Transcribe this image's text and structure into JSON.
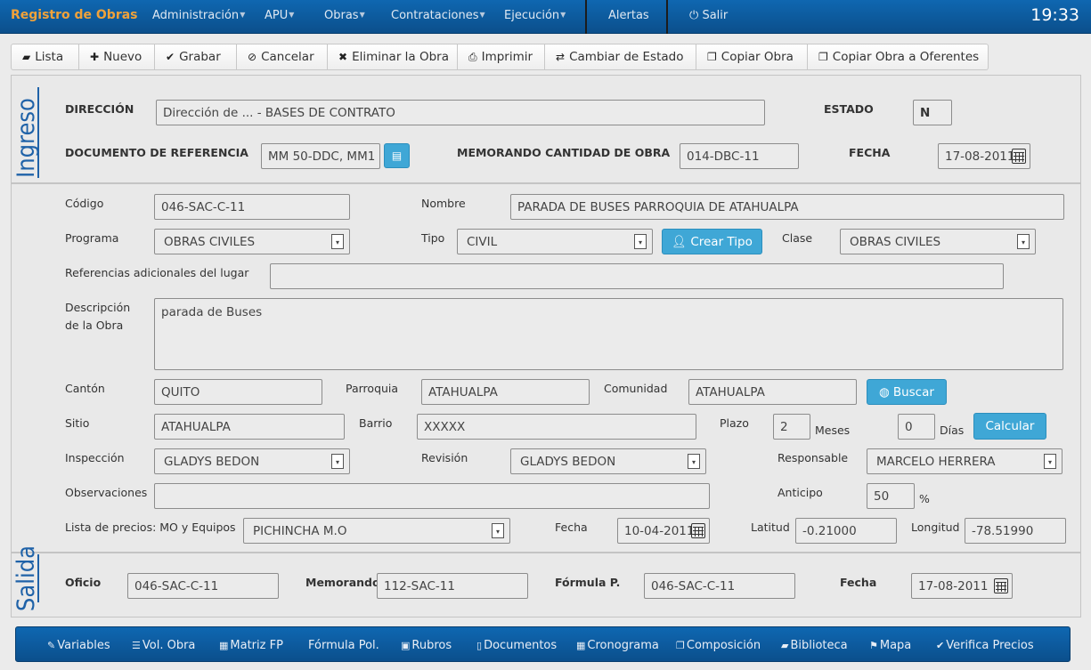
{
  "topbar": {
    "brand": "Registro de Obras",
    "menus": [
      "Administración",
      "APU",
      "Obras",
      "Contrataciones",
      "Ejecución"
    ],
    "alerts": "Alertas",
    "logout": "Salir",
    "clock": "19:33"
  },
  "toolbar": {
    "lista": "Lista",
    "nuevo": "Nuevo",
    "grabar": "Grabar",
    "cancelar": "Cancelar",
    "eliminar": "Eliminar la Obra",
    "imprimir": "Imprimir",
    "cambiar_estado": "Cambiar de Estado",
    "copiar": "Copiar Obra",
    "copiar_oferentes": "Copiar Obra a Oferentes"
  },
  "ingreso": {
    "side_label": "Ingreso",
    "direccion_label": "DIRECCIÓN",
    "direccion": "Dirección de ... - BASES DE CONTRATO",
    "estado_label": "ESTADO",
    "estado": "N",
    "doc_ref_label": "DOCUMENTO DE REFERENCIA",
    "doc_ref": "MM 50-DDC, MM1",
    "memo_label": "MEMORANDO CANTIDAD DE OBRA",
    "memo": "014-DBC-11",
    "fecha_label": "FECHA",
    "fecha": "17-08-2011"
  },
  "obra": {
    "codigo_label": "Código",
    "codigo": "046-SAC-C-11",
    "nombre_label": "Nombre",
    "nombre": "PARADA DE BUSES PARROQUIA DE ATAHUALPA",
    "programa_label": "Programa",
    "programa": "OBRAS CIVILES",
    "tipo_label": "Tipo",
    "tipo": "CIVIL",
    "crear_tipo": "Crear Tipo",
    "clase_label": "Clase",
    "clase": "OBRAS CIVILES",
    "referencias_label": "Referencias adicionales del lugar",
    "referencias": "",
    "descripcion_label_1": "Descripción",
    "descripcion_label_2": "de la Obra",
    "descripcion": "parada de Buses",
    "canton_label": "Cantón",
    "canton": "QUITO",
    "parroquia_label": "Parroquia",
    "parroquia": "ATAHUALPA",
    "comunidad_label": "Comunidad",
    "comunidad": "ATAHUALPA",
    "buscar": "Buscar",
    "sitio_label": "Sitio",
    "sitio": "ATAHUALPA",
    "barrio_label": "Barrio",
    "barrio": "XXXXX",
    "plazo_label": "Plazo",
    "plazo_meses": "2",
    "meses_label": "Meses",
    "plazo_dias": "0",
    "dias_label": "Días",
    "calcular": "Calcular",
    "inspeccion_label": "Inspección",
    "inspeccion": "GLADYS BEDON",
    "revision_label": "Revisión",
    "revision": "GLADYS BEDON",
    "responsable_label": "Responsable",
    "responsable": "MARCELO HERRERA",
    "observaciones_label": "Observaciones",
    "observaciones": "",
    "anticipo_label": "Anticipo",
    "anticipo": "50",
    "pct": "%",
    "lista_precios_label": "Lista de precios: MO y Equipos",
    "lista_precios": "PICHINCHA M.O",
    "fecha_label": "Fecha",
    "fecha": "10-04-2011",
    "latitud_label": "Latitud",
    "latitud": "-0.21000",
    "longitud_label": "Longitud",
    "longitud": "-78.51990"
  },
  "salida": {
    "side_label": "Salida",
    "oficio_label": "Oficio",
    "oficio": "046-SAC-C-11",
    "memorando_label": "Memorando",
    "memorando": "112-SAC-11",
    "formula_label": "Fórmula P.",
    "formula": "046-SAC-C-11",
    "fecha_label": "Fecha",
    "fecha": "17-08-2011"
  },
  "bottombar": {
    "variables": "Variables",
    "vol_obra": "Vol. Obra",
    "matriz_fp": "Matriz FP",
    "formula_pol": "Fórmula Pol.",
    "rubros": "Rubros",
    "documentos": "Documentos",
    "cronograma": "Cronograma",
    "composicion": "Composición",
    "biblioteca": "Biblioteca",
    "mapa": "Mapa",
    "verifica_precios": "Verifica Precios"
  },
  "colors": {
    "navbar": "#0b5da3",
    "brand": "#f0a23a",
    "accent_button": "#3fa7d6",
    "side_label": "#1f62a8"
  }
}
